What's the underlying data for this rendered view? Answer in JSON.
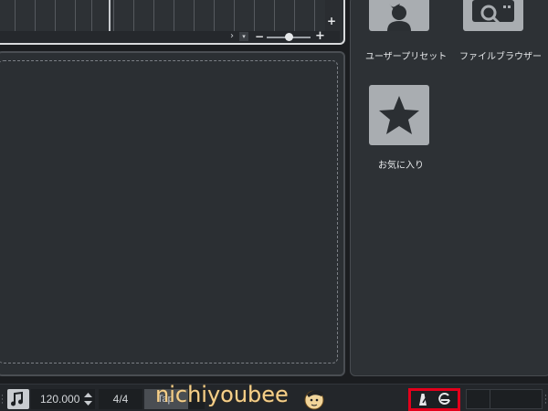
{
  "timeline": {
    "scroll_right_glyph": "›",
    "zoom_menu_glyph": "▾",
    "zoom_minus": "−",
    "zoom_plus": "+",
    "track_add": "+"
  },
  "media_panel": {
    "tiles": [
      {
        "label": "ユーザープリセット",
        "icon": "user-preset-icon"
      },
      {
        "label": "ファイルブラウザー",
        "icon": "file-browser-icon"
      },
      {
        "label": "お気に入り",
        "icon": "star-icon"
      }
    ]
  },
  "transport": {
    "tempo_mode_icon": "tempo-track-icon",
    "tempo": "120.000",
    "signature": "4/4",
    "tap_label": "Tap",
    "metronome_icon": "metronome-icon",
    "click_icon": "click-settings-icon"
  },
  "watermark": {
    "text": "nichiyoubee"
  },
  "colors": {
    "background": "#1b1d20",
    "panel": "#2b2f33",
    "tile": "#a9adb1",
    "highlight": "#e3001b",
    "watermark": "#f5cf8a"
  }
}
